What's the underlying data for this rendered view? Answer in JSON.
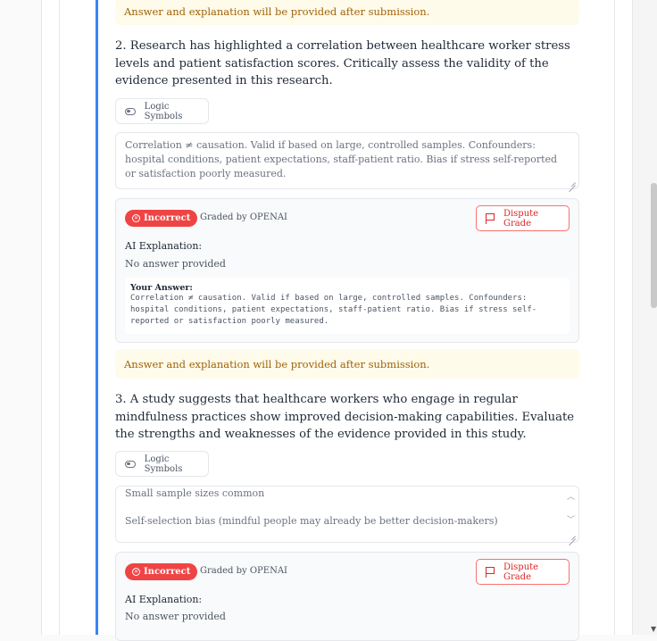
{
  "notice_text": "Answer and explanation will be provided after submission.",
  "logic_symbols_label": "Logic Symbols",
  "questions": [
    {
      "text": "2. Research has highlighted a correlation between healthcare worker stress levels and patient satisfaction scores. Critically assess the validity of the evidence presented in this research.",
      "answer_text": "Correlation ≠ causation. Valid if based on large, controlled samples. Confounders: hospital conditions, patient expectations, staff-patient ratio. Bias if stress self-reported or satisfaction poorly measured.",
      "grade": {
        "status": "Incorrect",
        "graded_by": "Graded by OPENAI",
        "dispute_label": "Dispute Grade",
        "ai_explanation_label": "AI Explanation:",
        "ai_explanation": "No answer provided",
        "your_answer_label": "Your Answer:",
        "your_answer": "Correlation ≠ causation. Valid if based on large, controlled samples. Confounders: hospital conditions, patient expectations, staff-patient ratio. Bias if stress self-reported or satisfaction poorly measured."
      }
    },
    {
      "text": "3. A study suggests that healthcare workers who engage in regular mindfulness practices show improved decision-making capabilities. Evaluate the strengths and weaknesses of the evidence provided in this study.",
      "answer_line1": "Small sample sizes common",
      "answer_line2": "Self-selection bias (mindful people may already be better decision-makers)",
      "grade": {
        "status": "Incorrect",
        "graded_by": "Graded by OPENAI",
        "dispute_label": "Dispute Grade",
        "ai_explanation_label": "AI Explanation:",
        "ai_explanation": "No answer provided"
      }
    }
  ],
  "colors": {
    "accent": "#3b82f6",
    "incorrect": "#ef4444",
    "notice_bg": "#fffbeb",
    "notice_text": "#a16207"
  }
}
